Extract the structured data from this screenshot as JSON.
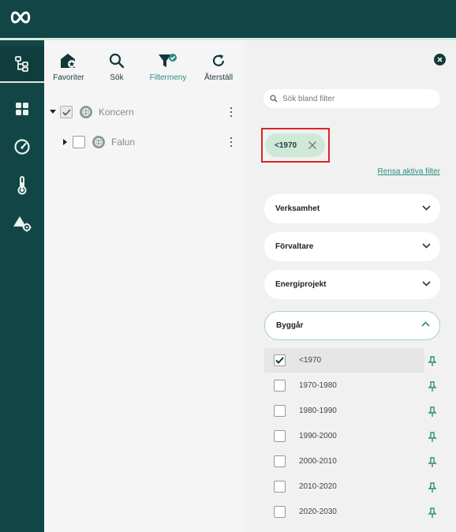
{
  "app": {
    "logo_icon": "infinity-logo-icon"
  },
  "colors": {
    "nav_bg": "#124546",
    "accent": "#2c8b82",
    "chip_bg": "#cfe8d8",
    "highlight": "#d92626"
  },
  "leftnav": {
    "items": [
      {
        "icon": "tree-structure-icon",
        "active": true
      },
      {
        "icon": "dashboard-grid-icon",
        "active": false
      },
      {
        "icon": "gauge-icon",
        "active": false
      },
      {
        "icon": "thermometer-icon",
        "active": false
      },
      {
        "icon": "triangle-settings-icon",
        "active": false
      }
    ]
  },
  "toolbar": {
    "favorites_label": "Favoriter",
    "search_label": "Sök",
    "filter_menu_label": "Filtermeny",
    "reset_label": "Återställ"
  },
  "tree": {
    "nodes": [
      {
        "label": "Koncern",
        "checked": true,
        "expanded": true
      },
      {
        "label": "Falun",
        "checked": false,
        "expanded": false
      }
    ]
  },
  "filter_panel": {
    "search_placeholder": "Sök bland filter",
    "active_chip": "<1970",
    "clear_label": "Rensa aktiva filter",
    "sections": {
      "verksamhet": "Verksamhet",
      "forvaltare": "Förvaltare",
      "energiprojekt": "Energiprojekt",
      "byggar": "Byggår"
    },
    "byggar_options": [
      {
        "label": "<1970",
        "checked": true
      },
      {
        "label": "1970-1980",
        "checked": false
      },
      {
        "label": "1980-1990",
        "checked": false
      },
      {
        "label": "1990-2000",
        "checked": false
      },
      {
        "label": "2000-2010",
        "checked": false
      },
      {
        "label": "2010-2020",
        "checked": false
      },
      {
        "label": "2020-2030",
        "checked": false
      }
    ]
  }
}
